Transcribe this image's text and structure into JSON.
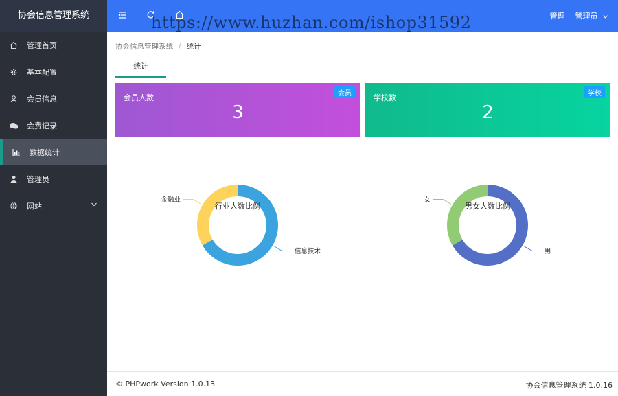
{
  "app": {
    "title": "协会信息管理系统"
  },
  "sidebar": {
    "items": [
      {
        "label": "管理首页",
        "icon": "home-icon"
      },
      {
        "label": "基本配置",
        "icon": "gear-icon"
      },
      {
        "label": "会员信息",
        "icon": "user-icon"
      },
      {
        "label": "会费记录",
        "icon": "coins-icon"
      },
      {
        "label": "数据统计",
        "icon": "bar-chart-icon",
        "active": true
      },
      {
        "label": "管理员",
        "icon": "person-icon"
      },
      {
        "label": "网站",
        "icon": "globe-icon",
        "expandable": true
      }
    ]
  },
  "topbar": {
    "menu_icon": "menu-fold-icon",
    "refresh_icon": "refresh-icon",
    "home_icon": "home-icon",
    "manage_label": "管理",
    "admin_label": "管理员",
    "watermark": "https://www.huzhan.com/ishop31592",
    "color": "#3575f5"
  },
  "breadcrumb": {
    "root": "协会信息管理系统",
    "sep": "/",
    "current": "统计"
  },
  "tab": {
    "label": "统计"
  },
  "cards": [
    {
      "title": "会员人数",
      "badge": "会员",
      "value": "3"
    },
    {
      "title": "学校数",
      "badge": "学校",
      "value": "2"
    }
  ],
  "chart_data": [
    {
      "type": "pie",
      "title": "行业人数比例",
      "categories": [
        "信息技术",
        "金融业"
      ],
      "values": [
        2,
        1
      ],
      "colors": [
        "#3ba3dd",
        "#fdd35c"
      ]
    },
    {
      "type": "pie",
      "title": "男女人数比例",
      "categories": [
        "男",
        "女"
      ],
      "values": [
        2,
        1
      ],
      "colors": [
        "#5470c6",
        "#91cc75"
      ]
    }
  ],
  "footer": {
    "left": "© PHPwork Version 1.0.13",
    "right": "协会信息管理系统 1.0.16"
  }
}
